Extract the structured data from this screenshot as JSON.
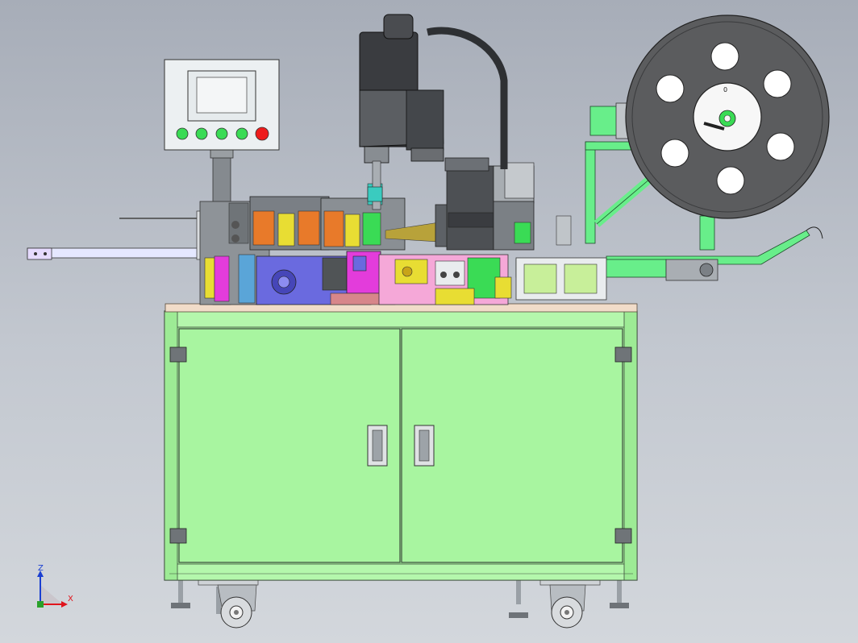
{
  "axis_triad": {
    "z_label": "Z",
    "x_label": "X"
  },
  "reel": {
    "index_mark": "0"
  },
  "colors": {
    "cabinet": "#a8f5a0",
    "frame_green": "#68ee8a",
    "hmi_panel": "#ecf0f2",
    "button_green": "#3adb55",
    "button_red": "#ee1c1c",
    "robot_dark": "#3a3c40",
    "reel": "#5b5c5e",
    "table_top": "#f1dcc9",
    "magenta": "#e33cdb",
    "pink": "#f5a8d8",
    "yellow": "#e8dd33",
    "blue_block": "#6a6adf",
    "orange": "#e87a2a"
  }
}
